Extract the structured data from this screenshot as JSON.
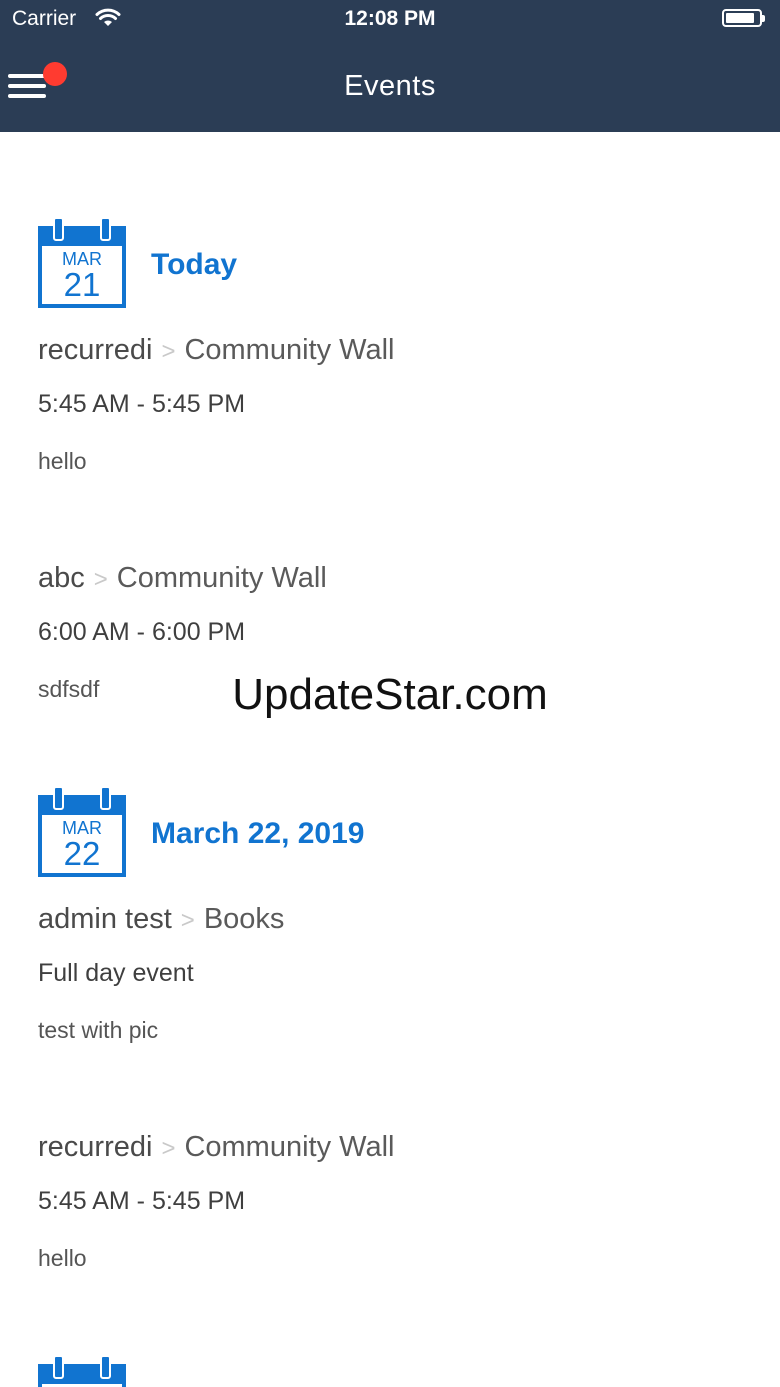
{
  "status_bar": {
    "carrier": "Carrier",
    "time": "12:08 PM"
  },
  "nav": {
    "title": "Events"
  },
  "groups": [
    {
      "cal_month": "MAR",
      "cal_day": "21",
      "label": "Today",
      "events": [
        {
          "name": "recurredi",
          "separator": ">",
          "group": "Community Wall",
          "time": "5:45 AM - 5:45 PM",
          "description": "hello"
        },
        {
          "name": "abc",
          "separator": ">",
          "group": "Community Wall",
          "time": "6:00 AM - 6:00 PM",
          "description": "sdfsdf"
        }
      ]
    },
    {
      "cal_month": "MAR",
      "cal_day": "22",
      "label": "March 22, 2019",
      "events": [
        {
          "name": "admin test",
          "separator": ">",
          "group": "Books",
          "time": "Full day event",
          "description": "test with pic"
        },
        {
          "name": "recurredi",
          "separator": ">",
          "group": "Community Wall",
          "time": "5:45 AM - 5:45 PM",
          "description": "hello"
        }
      ]
    }
  ],
  "watermark": "UpdateStar.com",
  "colors": {
    "navbar": "#2b3d55",
    "accent": "#1174d0",
    "badge": "#ff3b30"
  }
}
